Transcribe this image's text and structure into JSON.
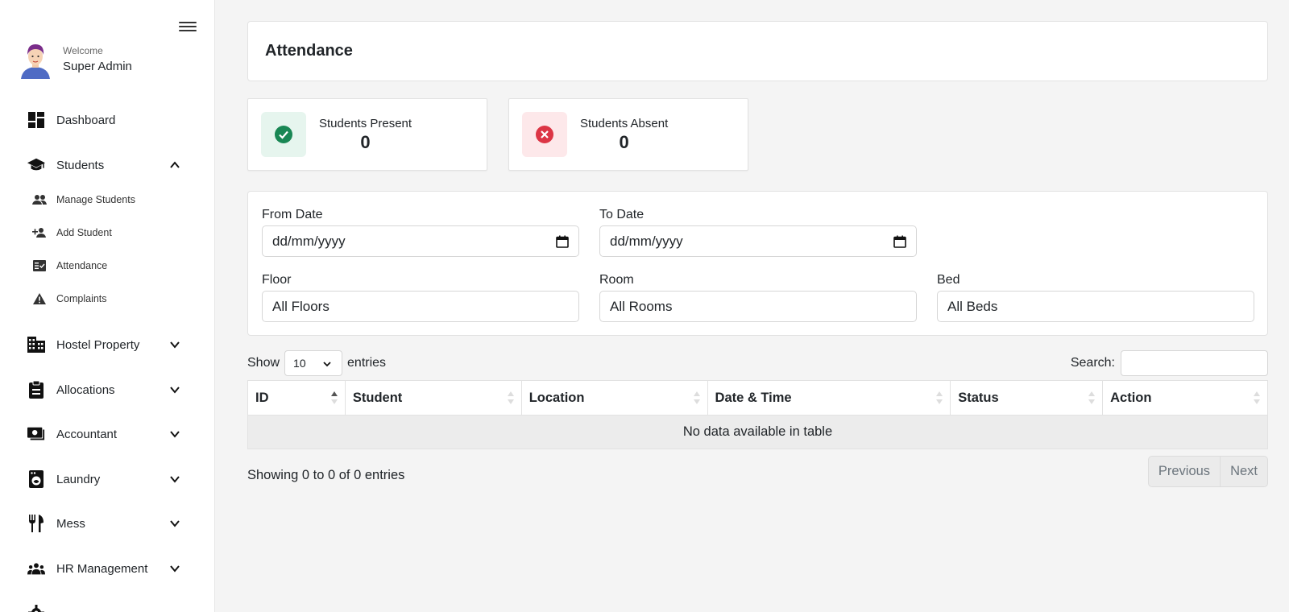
{
  "user": {
    "welcome": "Welcome",
    "name": "Super Admin"
  },
  "nav": {
    "dashboard": "Dashboard",
    "students": "Students",
    "students_sub": {
      "manage": "Manage Students",
      "add": "Add Student",
      "attendance": "Attendance",
      "complaints": "Complaints"
    },
    "hostel_property": "Hostel Property",
    "allocations": "Allocations",
    "accountant": "Accountant",
    "laundry": "Laundry",
    "mess": "Mess",
    "hr_management": "HR Management"
  },
  "page": {
    "title": "Attendance"
  },
  "stats": {
    "present": {
      "label": "Students Present",
      "value": "0",
      "color": "#198754",
      "bg": "#e6f5ee"
    },
    "absent": {
      "label": "Students Absent",
      "value": "0",
      "color": "#dc3545",
      "bg": "#fde8ea"
    }
  },
  "filters": {
    "from_date": {
      "label": "From Date",
      "placeholder": "dd/mm/yyyy"
    },
    "to_date": {
      "label": "To Date",
      "placeholder": "dd/mm/yyyy"
    },
    "floor": {
      "label": "Floor",
      "value": "All Floors"
    },
    "room": {
      "label": "Room",
      "value": "All Rooms"
    },
    "bed": {
      "label": "Bed",
      "value": "All Beds"
    }
  },
  "table": {
    "show_label": "Show",
    "entries_label": "entries",
    "page_length": "10",
    "search_label": "Search:",
    "columns": [
      "ID",
      "Student",
      "Location",
      "Date & Time",
      "Status",
      "Action"
    ],
    "empty_text": "No data available in table",
    "info": "Showing 0 to 0 of 0 entries",
    "prev_label": "Previous",
    "next_label": "Next"
  }
}
